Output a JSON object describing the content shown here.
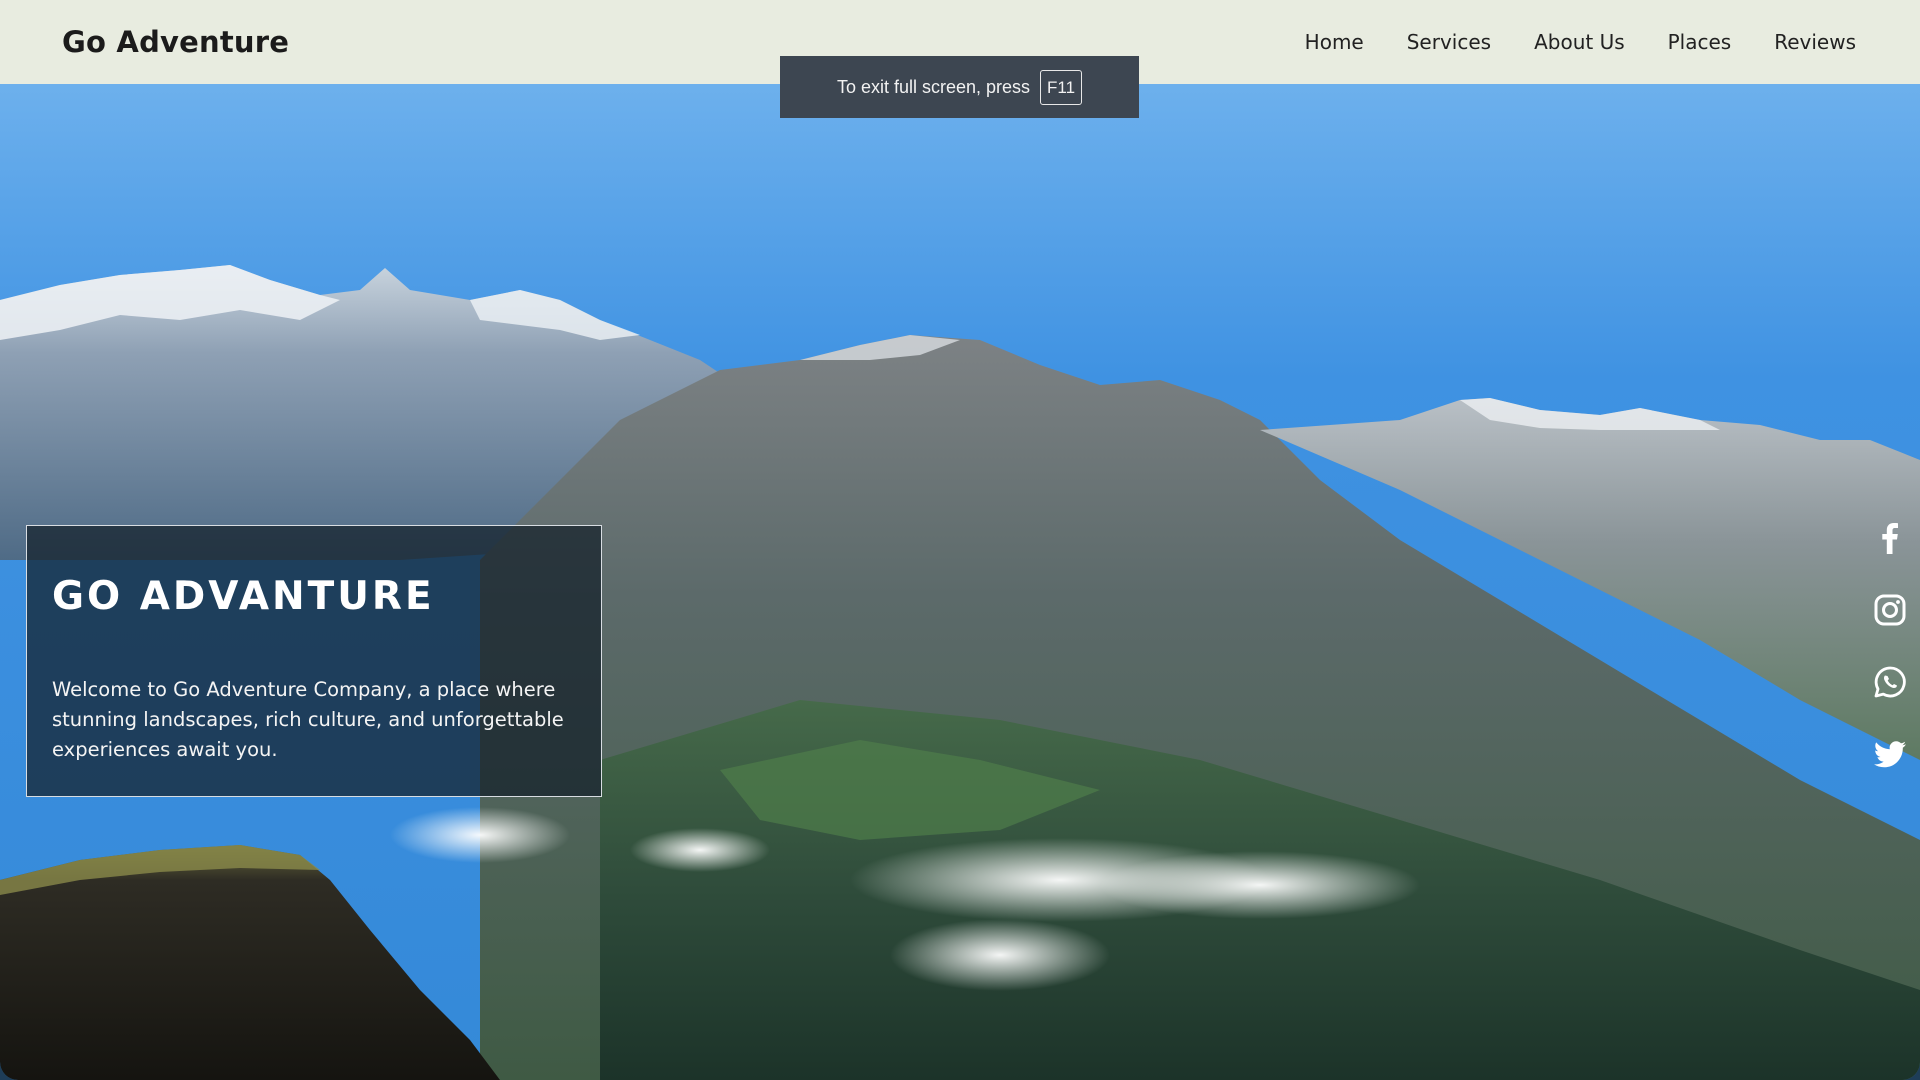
{
  "header": {
    "brand": "Go Adventure",
    "nav": [
      {
        "label": "Home"
      },
      {
        "label": "Services"
      },
      {
        "label": "About Us"
      },
      {
        "label": "Places"
      },
      {
        "label": "Reviews"
      }
    ]
  },
  "fullscreen_toast": {
    "message": "To exit full screen, press",
    "key": "F11"
  },
  "hero": {
    "title": "GO ADVANTURE",
    "description": "Welcome to Go Adventure Company, a place where stunning landscapes, rich culture, and unforgettable experiences await you."
  },
  "social": [
    {
      "icon": "facebook-icon"
    },
    {
      "icon": "instagram-icon"
    },
    {
      "icon": "whatsapp-icon"
    },
    {
      "icon": "twitter-icon"
    }
  ],
  "colors": {
    "header_bg": "#e8ece0",
    "toast_bg": "#3d4651",
    "card_bg": "#14202a",
    "sky": "#4f9fe6"
  }
}
